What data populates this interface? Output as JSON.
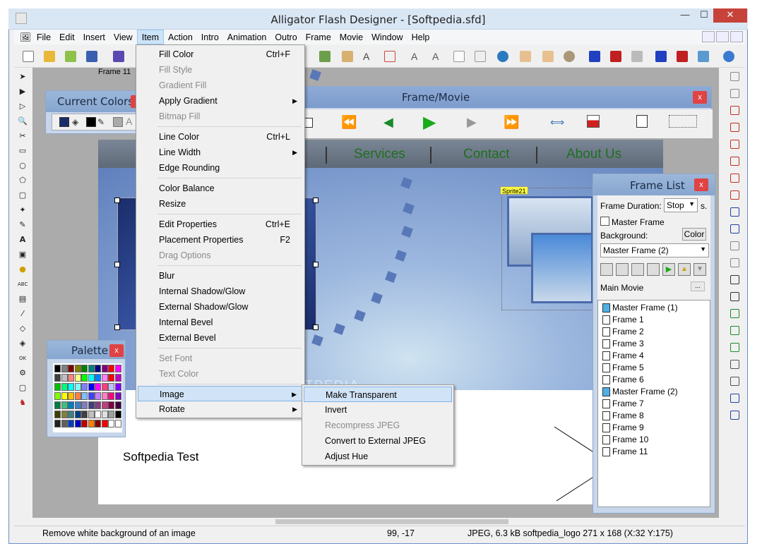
{
  "window": {
    "title": "Alligator Flash Designer - [Softpedia.sfd]",
    "min": "—",
    "max": "☐",
    "close": "✕"
  },
  "menubar": [
    "File",
    "Edit",
    "Insert",
    "View",
    "Item",
    "Action",
    "Intro",
    "Animation",
    "Outro",
    "Frame",
    "Movie",
    "Window",
    "Help"
  ],
  "active_menu": "Item",
  "frame_label": "Frame 11",
  "current_colors": {
    "title": "Current Colors",
    "close": "x"
  },
  "framemovie": {
    "title": "Frame/Movie",
    "close": "x"
  },
  "nav": {
    "services": "Services",
    "contact": "Contact",
    "about": "About Us"
  },
  "sprite_label": "Sprite21",
  "stage_text": "Softpedia Test",
  "watermark": "SOFTPEDIA",
  "palette": {
    "title": "Palette",
    "close": "x"
  },
  "palette_colors": [
    "#000000",
    "#808080",
    "#800000",
    "#808000",
    "#008000",
    "#008080",
    "#000080",
    "#800080",
    "#ff0000",
    "#ff00ff",
    "#404040",
    "#c0c0c0",
    "#ff8080",
    "#ffff80",
    "#00ff00",
    "#00ffff",
    "#0080ff",
    "#ff80ff",
    "#ff0000",
    "#c000c0",
    "#00c000",
    "#00ff80",
    "#00ffff",
    "#80ffff",
    "#8080ff",
    "#0000ff",
    "#ff00ff",
    "#ff4080",
    "#c0c0ff",
    "#8000ff",
    "#80ff00",
    "#ffff00",
    "#ffc000",
    "#ff8040",
    "#80c0ff",
    "#4040ff",
    "#c080ff",
    "#ff80c0",
    "#ff0080",
    "#8000c0",
    "#008040",
    "#40c080",
    "#0080c0",
    "#4080c0",
    "#8080c0",
    "#404080",
    "#804080",
    "#c04080",
    "#800040",
    "#400040",
    "#404000",
    "#808040",
    "#408080",
    "#004080",
    "#404040",
    "#c0c0c0",
    "#ffffff",
    "#e0e0e0",
    "#a0a0a0",
    "#000000",
    "#202020",
    "#606060",
    "#0040c0",
    "#0000c0",
    "#c00000",
    "#ff8000",
    "#800000",
    "#ff0000",
    "#ffffff",
    "#ffffff"
  ],
  "item_menu": {
    "fill_color": "Fill Color",
    "fill_color_sc": "Ctrl+F",
    "fill_style": "Fill Style",
    "gradient_fill": "Gradient Fill",
    "apply_gradient": "Apply Gradient",
    "bitmap_fill": "Bitmap Fill",
    "line_color": "Line Color",
    "line_color_sc": "Ctrl+L",
    "line_width": "Line Width",
    "edge_rounding": "Edge Rounding",
    "color_balance": "Color Balance",
    "resize": "Resize",
    "edit_properties": "Edit Properties",
    "edit_properties_sc": "Ctrl+E",
    "placement_properties": "Placement Properties",
    "placement_properties_sc": "F2",
    "drag_options": "Drag Options",
    "blur": "Blur",
    "internal_shadow": "Internal Shadow/Glow",
    "external_shadow": "External Shadow/Glow",
    "internal_bevel": "Internal Bevel",
    "external_bevel": "External Bevel",
    "set_font": "Set Font",
    "text_color": "Text Color",
    "image": "Image",
    "rotate": "Rotate"
  },
  "image_submenu": {
    "make_transparent": "Make Transparent",
    "invert": "Invert",
    "recompress": "Recompress JPEG",
    "convert": "Convert to External JPEG",
    "adjust_hue": "Adjust Hue"
  },
  "framelist": {
    "title": "Frame List",
    "close": "x",
    "duration_label": "Frame Duration:",
    "duration_value": "Stop",
    "duration_unit": "s.",
    "master_frame_label": "Master Frame",
    "background_label": "Background:",
    "color_btn": "Color",
    "master_select": "Master Frame (2)",
    "main_movie": "Main Movie",
    "ellipsis": "...",
    "frames": [
      "Master Frame (1)",
      "Frame 1",
      "Frame 2",
      "Frame 3",
      "Frame 4",
      "Frame 5",
      "Frame 6",
      "Master Frame (2)",
      "Frame 7",
      "Frame 8",
      "Frame 9",
      "Frame 10",
      "Frame 11"
    ]
  },
  "status": {
    "hint": "Remove white background of an image",
    "coords": "99, -17",
    "info": "JPEG, 6.3 kB softpedia_logo 271 x 168 (X:32 Y:175)"
  },
  "colors": {
    "accent": "#cce4f7",
    "panel": "#c7d6ea",
    "nav_green": "#1f6f1f",
    "close_red": "#e04343"
  }
}
